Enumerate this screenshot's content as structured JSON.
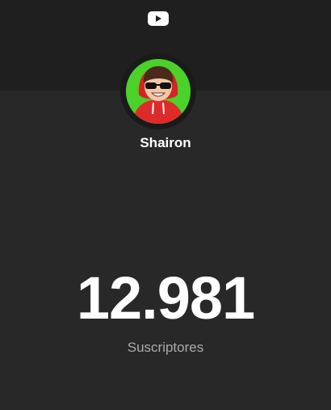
{
  "header": {
    "logo_icon": "youtube-play-icon"
  },
  "channel": {
    "name": "Shairon",
    "avatar_icon": "avatar-cartoon-red-hoodie-sunglasses"
  },
  "stats": {
    "subscriber_count": "12.981",
    "subscriber_label": "Suscriptores"
  },
  "colors": {
    "background": "#282828",
    "top_band": "#1f1f1f",
    "avatar_bg": "#4ad12a",
    "hoodie": "#e02a2a",
    "label": "#aaaaaa"
  }
}
